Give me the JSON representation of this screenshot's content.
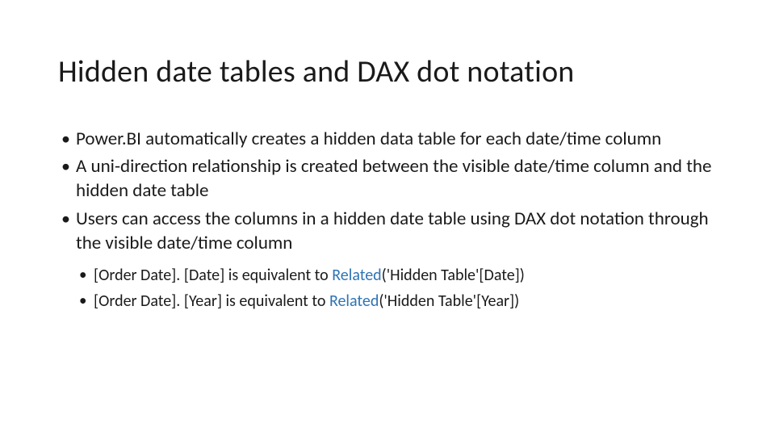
{
  "title": "Hidden date tables and DAX dot notation",
  "bullets": [
    "Power.BI automatically creates a hidden data table for each date/time column",
    "A uni-direction relationship is created between the visible date/time column and the hidden date table",
    "Users can access the columns in a hidden date table using DAX dot notation through the visible date/time column"
  ],
  "subbullets": [
    {
      "plain1": "[Order Date]. [Date] is equivalent to ",
      "kw": "Related",
      "plain2": "('Hidden Table'[Date])"
    },
    {
      "plain1": "[Order Date]. [Year] is equivalent to ",
      "kw": "Related",
      "plain2": "('Hidden Table'[Year])"
    }
  ]
}
